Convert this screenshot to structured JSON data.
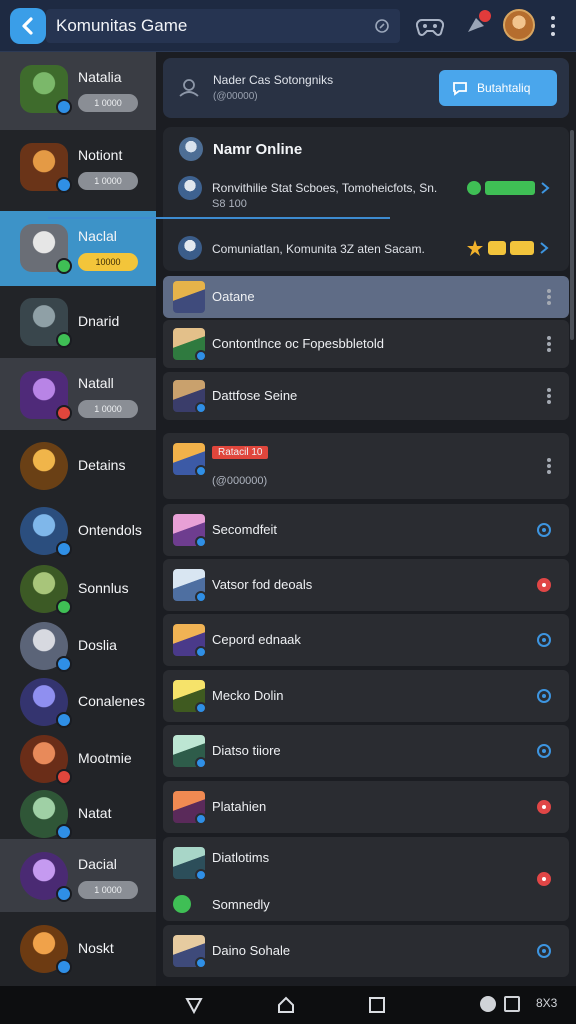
{
  "header": {
    "title": "Komunitas Game",
    "icons": [
      "back-arrow-icon",
      "search-circle-icon",
      "controller-icon",
      "notifications-icon",
      "profile-avatar",
      "more-vert-icon"
    ]
  },
  "sidebar": {
    "items": [
      {
        "name": "Natalia",
        "pill": "1 0000",
        "state": "shaded",
        "badge": "blue"
      },
      {
        "name": "Notiont",
        "pill": "1 0000",
        "state": "dark",
        "badge": "blue"
      },
      {
        "name": "Naclal",
        "pill": "10000",
        "state": "active",
        "badge": "green"
      },
      {
        "name": "Dnarid",
        "pill": "",
        "state": "dark",
        "badge": "green"
      },
      {
        "name": "Natall",
        "pill": "1 0000",
        "state": "shaded",
        "badge": "red"
      },
      {
        "name": "Detains",
        "pill": "",
        "state": "dark",
        "badge": ""
      },
      {
        "name": "Ontendols",
        "pill": "",
        "state": "dark",
        "badge": "blue"
      },
      {
        "name": "Sonnlus",
        "pill": "",
        "state": "dark",
        "badge": "green"
      },
      {
        "name": "Doslia",
        "pill": "",
        "state": "dark",
        "badge": "blue"
      },
      {
        "name": "Conalenes",
        "pill": "",
        "state": "dark",
        "badge": "blue"
      },
      {
        "name": "Mootmie",
        "pill": "",
        "state": "dark",
        "badge": "red"
      },
      {
        "name": "Natat",
        "pill": "",
        "state": "dark",
        "badge": "blue"
      },
      {
        "name": "Dacial",
        "pill": "1 0000",
        "state": "shaded",
        "badge": "blue"
      },
      {
        "name": "Noskt",
        "pill": "",
        "state": "dark",
        "badge": "blue"
      }
    ]
  },
  "banner": {
    "title": "Nader Cas Sotongniks",
    "subtitle": "(@00000)",
    "button_label": "Butahtaliq"
  },
  "online_panel": {
    "title": "Namr Online",
    "rows": [
      {
        "text": "Ronvithilie Stat Scboes, Tomoheicfots, Sn.",
        "sub": "S8 100"
      },
      {
        "text": "Comuniatlan, Komunita 3Z aten Sacam.",
        "sub": ""
      }
    ]
  },
  "list": [
    {
      "label": "Oatane",
      "trail": "dots",
      "selected": true
    },
    {
      "label": "Contontlnce oc Fopesbbletold",
      "trail": "dots"
    },
    {
      "label": "Dattfose Seine",
      "trail": "dots"
    },
    {
      "label": "Ratacil 10",
      "sub": "(@000000)",
      "trail": "dots"
    },
    {
      "label": "Secomdfeit",
      "trail": "blue"
    },
    {
      "label": "Vatsor fod deoals",
      "trail": "red"
    },
    {
      "label": "Cepord ednaak",
      "trail": "blue"
    },
    {
      "label": "Mecko Dolin",
      "trail": "blue"
    },
    {
      "label": "Diatso tiiore",
      "trail": "blue"
    },
    {
      "label": "Platahien",
      "trail": "red"
    },
    {
      "label": "Diatlotims",
      "sub": "Somnedly",
      "trail": "red"
    },
    {
      "label": "Daino Sohale",
      "trail": "blue"
    }
  ],
  "navbar": {
    "right_text": "8X3"
  }
}
